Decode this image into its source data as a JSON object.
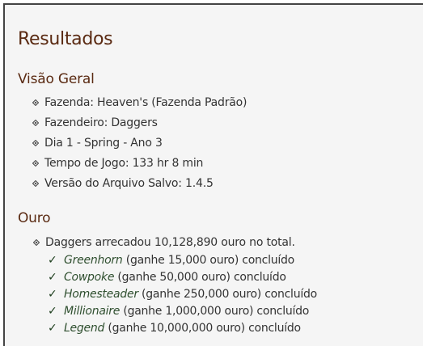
{
  "page": {
    "title": "Resultados"
  },
  "overview": {
    "title": "Visão Geral",
    "items": [
      "Fazenda: Heaven's (Fazenda Padrão)",
      "Fazendeiro: Daggers",
      "Dia 1 - Spring - Ano 3",
      "Tempo de Jogo: 133 hr 8 min",
      "Versão do Arquivo Salvo: 1.4.5"
    ]
  },
  "gold": {
    "title": "Ouro",
    "summary": "Daggers arrecadou 10,128,890 ouro no total.",
    "achievements": [
      {
        "check": "✓",
        "name": "Greenhorn",
        "detail": " (ganhe 15,000 ouro) concluído"
      },
      {
        "check": "✓",
        "name": "Cowpoke",
        "detail": " (ganhe 50,000 ouro) concluído"
      },
      {
        "check": "✓",
        "name": "Homesteader",
        "detail": " (ganhe 250,000 ouro) concluído"
      },
      {
        "check": "✓",
        "name": "Millionaire",
        "detail": " (ganhe 1,000,000 ouro) concluído"
      },
      {
        "check": "✓",
        "name": "Legend",
        "detail": " (ganhe 10,000,000 ouro) concluído"
      }
    ]
  },
  "colors": {
    "heading": "#5a2a12",
    "text": "#333333",
    "achievement": "#2f4f2f",
    "background": "#f5f5f5"
  },
  "icons": {
    "bullet": "diamond-bullet-icon",
    "check": "checkmark-icon"
  }
}
